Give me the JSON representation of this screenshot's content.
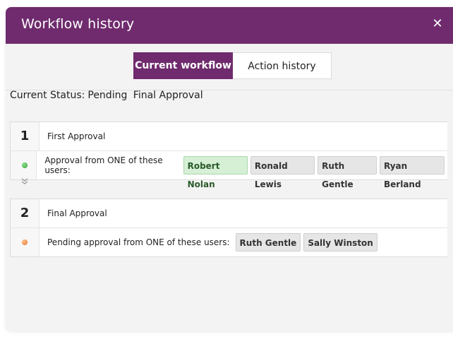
{
  "dialog": {
    "title": "Workflow history",
    "close_glyph": "✕"
  },
  "tabs": [
    {
      "label": "Current workflow",
      "active": true
    },
    {
      "label": "Action history",
      "active": false
    }
  ],
  "status": {
    "prefix": "Current Status:",
    "state": "Pending",
    "step": "Final Approval"
  },
  "steps": [
    {
      "number": "1",
      "title": "First Approval",
      "status_color": "#2f9e34",
      "instruction": "Approval from ONE of these users:",
      "users": [
        {
          "name": "Robert Nolan",
          "approved": true
        },
        {
          "name": "Ronald Lewis",
          "approved": false
        },
        {
          "name": "Ruth Gentle",
          "approved": false
        },
        {
          "name": "Ryan Berland",
          "approved": false
        }
      ]
    },
    {
      "number": "2",
      "title": "Final Approval",
      "status_color": "#e2702a",
      "instruction": "Pending approval from ONE of these users:",
      "users": [
        {
          "name": "Ruth Gentle",
          "approved": false
        },
        {
          "name": "Sally Winston",
          "approved": false
        }
      ]
    }
  ],
  "icons": {
    "separator": "chevron-double-down-icon"
  },
  "colors": {
    "brand": "#6f2b6e",
    "approved_chip": "#d5f0d5"
  }
}
